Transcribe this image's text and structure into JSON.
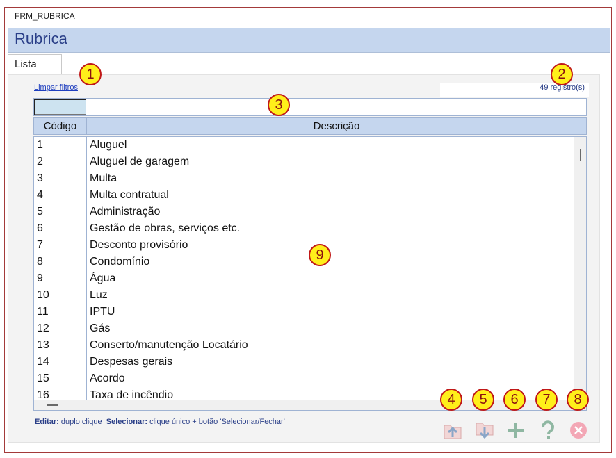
{
  "window": {
    "title": "FRM_RUBRICA"
  },
  "header": {
    "title": "Rubrica"
  },
  "tabs": [
    {
      "label": "Lista"
    }
  ],
  "filters": {
    "clear_link": "Limpar filtros",
    "record_count": "49 registro(s)",
    "code_filter_value": "",
    "description_filter_value": ""
  },
  "list": {
    "columns": [
      "Código",
      "Descrição"
    ],
    "rows": [
      {
        "code": "1",
        "description": "Aluguel"
      },
      {
        "code": "2",
        "description": "Aluguel de garagem"
      },
      {
        "code": "3",
        "description": "Multa"
      },
      {
        "code": "4",
        "description": "Multa contratual"
      },
      {
        "code": "5",
        "description": "Administração"
      },
      {
        "code": "6",
        "description": "Gestão de obras, serviços etc."
      },
      {
        "code": "7",
        "description": "Desconto provisório"
      },
      {
        "code": "8",
        "description": "Condomínio"
      },
      {
        "code": "9",
        "description": "Água"
      },
      {
        "code": "10",
        "description": "Luz"
      },
      {
        "code": "11",
        "description": "IPTU"
      },
      {
        "code": "12",
        "description": "Gás"
      },
      {
        "code": "13",
        "description": "Conserto/manutenção Locatário"
      },
      {
        "code": "14",
        "description": "Despesas gerais"
      },
      {
        "code": "15",
        "description": "Acordo"
      },
      {
        "code": "16",
        "description": "Taxa de incêndio"
      }
    ]
  },
  "hint": {
    "edit_label": "Editar:",
    "edit_text": "duplo clique",
    "select_label": "Selecionar:",
    "select_text": "clique único + botão 'Selecionar/Fechar'"
  },
  "callouts": [
    "1",
    "2",
    "3",
    "4",
    "5",
    "6",
    "7",
    "8",
    "9"
  ],
  "toolbar": {
    "buttons": [
      {
        "icon": "folder-upload-icon"
      },
      {
        "icon": "folder-download-icon"
      },
      {
        "icon": "plus-icon"
      },
      {
        "icon": "help-icon"
      },
      {
        "icon": "close-icon"
      }
    ]
  },
  "colors": {
    "header_band": "#c5d6ee",
    "title_text": "#2a3f88",
    "window_border": "#a33a3a",
    "callout_fill": "#ffef1a",
    "callout_border": "#c01818"
  }
}
